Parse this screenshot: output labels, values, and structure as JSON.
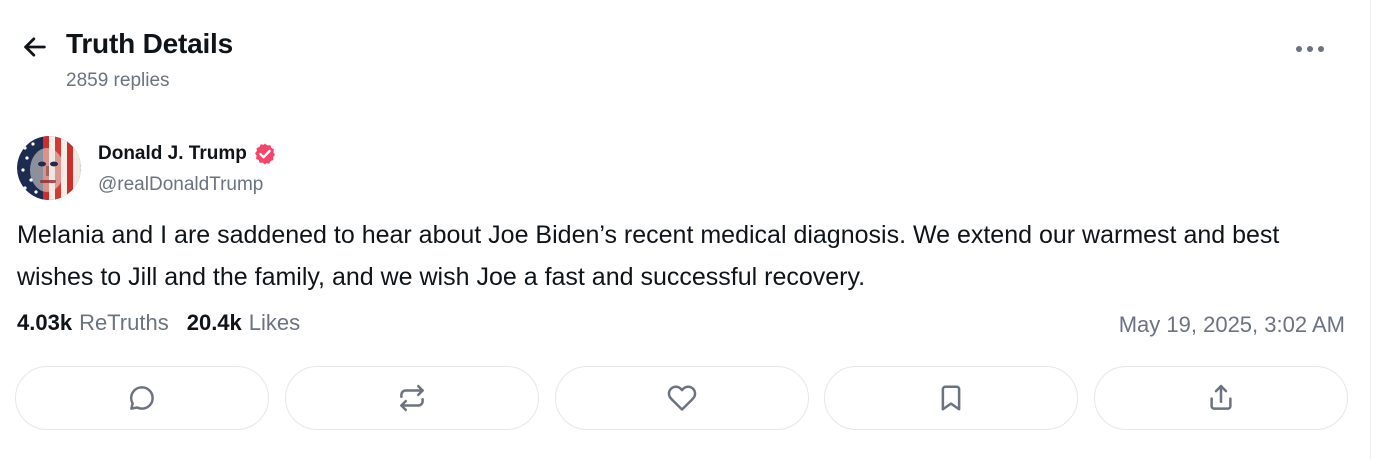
{
  "header": {
    "title": "Truth Details",
    "replies": "2859 replies",
    "back_icon": "arrow-left-icon",
    "more_icon": "more-horizontal-icon"
  },
  "author": {
    "name": "Donald J. Trump",
    "handle": "@realDonaldTrump",
    "verified": true,
    "verified_color": "#f2466b"
  },
  "post": {
    "text": "Melania and I are saddened to hear about Joe Biden’s recent medical diagnosis. We extend our warmest and best wishes to Jill and the family, and we wish Joe a fast and successful recovery."
  },
  "stats": {
    "retruths_value": "4.03k",
    "retruths_label": "ReTruths",
    "likes_value": "20.4k",
    "likes_label": "Likes",
    "timestamp": "May 19, 2025, 3:02 AM"
  },
  "actions": [
    {
      "name": "reply",
      "icon": "comment-icon"
    },
    {
      "name": "retruth",
      "icon": "repost-icon"
    },
    {
      "name": "like",
      "icon": "heart-icon"
    },
    {
      "name": "bookmark",
      "icon": "bookmark-icon"
    },
    {
      "name": "share",
      "icon": "share-icon"
    }
  ],
  "colors": {
    "text_primary": "#0f1419",
    "text_secondary": "#6b7280",
    "icon": "#6b7280",
    "border": "#e5e7eb"
  }
}
